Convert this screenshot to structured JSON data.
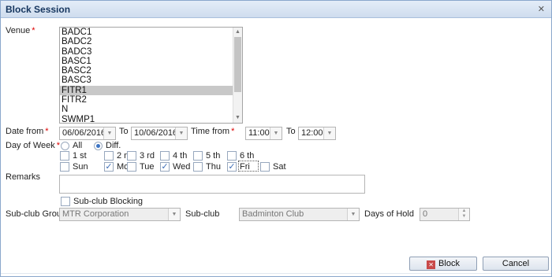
{
  "dialog": {
    "title": "Block Session"
  },
  "venue": {
    "label": "Venue",
    "required_mark": "*",
    "items": [
      "BADC1",
      "BADC2",
      "BADC3",
      "BASC1",
      "BASC2",
      "BASC3",
      "FITR1",
      "FITR2",
      "N",
      "SWMP1"
    ],
    "selected": "FITR1"
  },
  "date": {
    "from_label": "Date from",
    "required_mark": "*",
    "from_value": "06/06/2016",
    "to_label": "To",
    "to_value": "10/06/2016"
  },
  "time": {
    "from_label": "Time from",
    "required_mark": "*",
    "from_value": "11:00",
    "to_label": "To",
    "to_value": "12:00"
  },
  "day_of_week": {
    "label": "Day of Week",
    "required_mark": "*",
    "options": [
      {
        "label": "All",
        "selected": false
      },
      {
        "label": "Diff.",
        "selected": true
      }
    ],
    "weeks": [
      {
        "label": "1 st",
        "checked": false
      },
      {
        "label": "2 nd",
        "checked": false
      },
      {
        "label": "3 rd",
        "checked": false
      },
      {
        "label": "4 th",
        "checked": false
      },
      {
        "label": "5 th",
        "checked": false
      },
      {
        "label": "6 th",
        "checked": false
      }
    ],
    "days": [
      {
        "label": "Sun",
        "checked": false
      },
      {
        "label": "Mon",
        "checked": true
      },
      {
        "label": "Tue",
        "checked": false
      },
      {
        "label": "Wed",
        "checked": true
      },
      {
        "label": "Thu",
        "checked": false
      },
      {
        "label": "Fri",
        "checked": true
      },
      {
        "label": "Sat",
        "checked": false
      }
    ]
  },
  "remarks": {
    "label": "Remarks",
    "value": ""
  },
  "subclub_blocking": {
    "label": "Sub-club Blocking",
    "checked": false
  },
  "subclub_group": {
    "label": "Sub-club Group",
    "value": "MTR Corporation"
  },
  "subclub": {
    "label": "Sub-club",
    "value": "Badminton Club"
  },
  "days_of_hold": {
    "label": "Days of Hold",
    "value": "0"
  },
  "buttons": {
    "block": "Block",
    "cancel": "Cancel"
  }
}
